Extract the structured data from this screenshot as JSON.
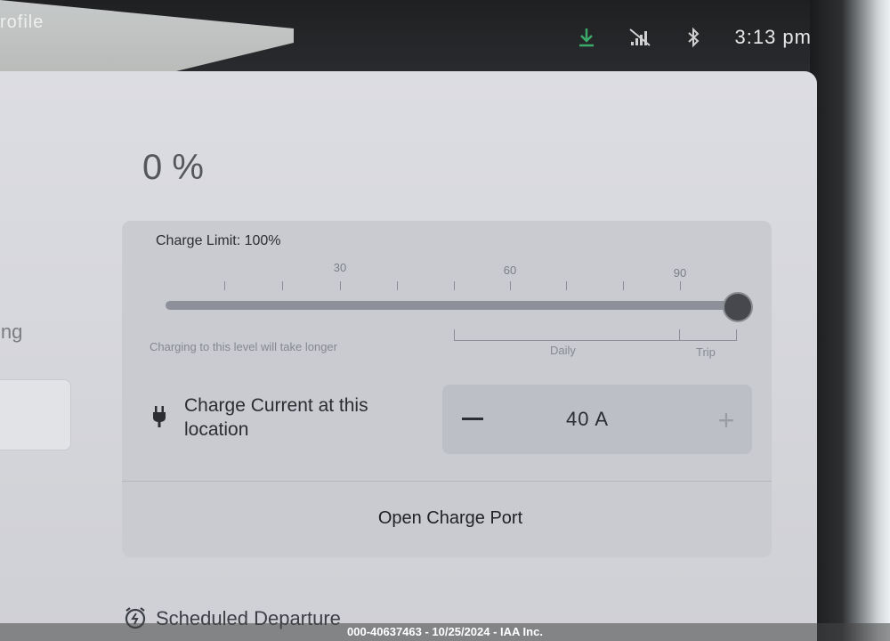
{
  "top_left_partial_label": "rofile",
  "status_bar": {
    "time": "3:13 pm",
    "icons": [
      "download-icon",
      "no-signal-icon",
      "bluetooth-icon"
    ]
  },
  "left_partial_label": "ing",
  "battery": {
    "percent_text": "0 %"
  },
  "charge_limit": {
    "label": "Charge Limit: 100%",
    "value_percent": 100,
    "tick_labels": [
      "30",
      "60",
      "90"
    ],
    "hint": "Charging to this level will take longer",
    "range_labels": {
      "daily": "Daily",
      "trip": "Trip"
    }
  },
  "charge_current": {
    "label": "Charge Current at this location",
    "value": "40  A",
    "minus_symbol": "−",
    "plus_symbol": "+"
  },
  "open_charge_port_label": "Open Charge Port",
  "scheduled_departure_label": "Scheduled Departure",
  "watermark": "000-40637463 - 10/25/2024 - IAA Inc.",
  "colors": {
    "accent_green": "#3aa96a",
    "panel_bg": "#d7d8dd"
  }
}
